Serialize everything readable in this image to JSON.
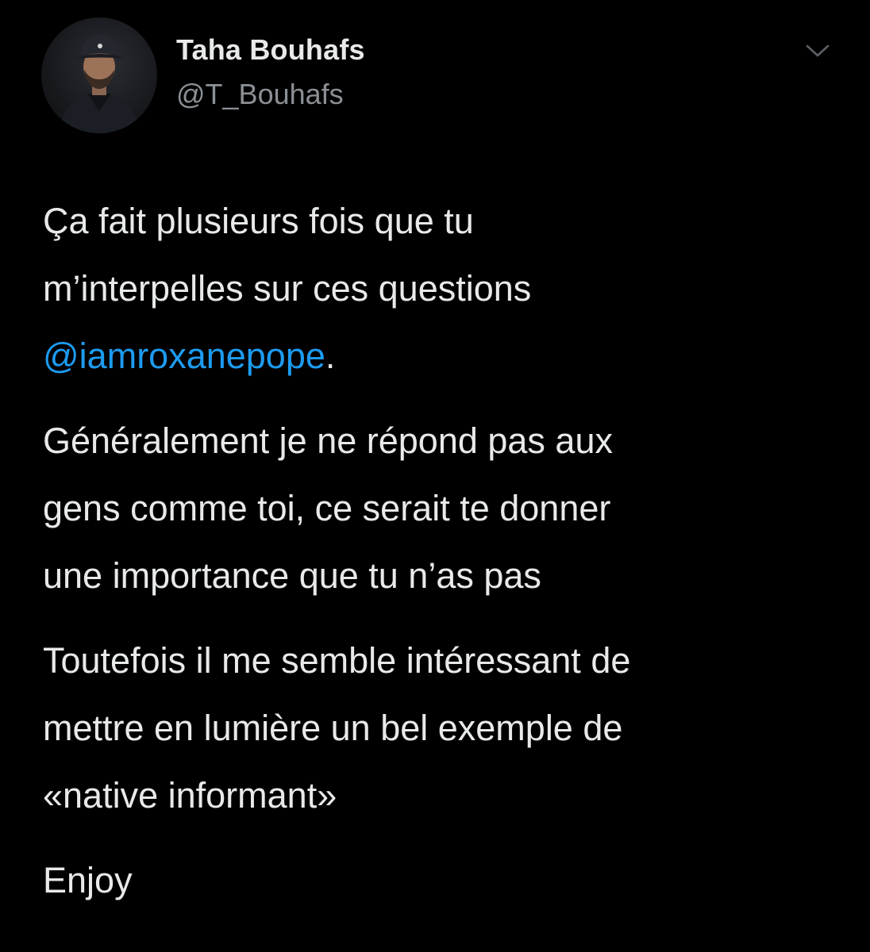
{
  "author": {
    "display_name": "Taha Bouhafs",
    "handle": "@T_Bouhafs",
    "avatar_icon": "user-avatar-photo"
  },
  "menu": {
    "icon": "chevron-down-icon"
  },
  "tweet": {
    "p1_line1": "Ça fait plusieurs fois que tu",
    "p1_line2": "m’interpelles sur ces questions",
    "p1_mention": "@iamroxanepope",
    "p1_after_mention": ".",
    "p2_line1": "Généralement je ne répond pas aux",
    "p2_line2": "gens comme toi, ce serait te donner",
    "p2_line3": "une importance que tu n’as pas",
    "p3_line1": "Toutefois il me semble intéressant de",
    "p3_line2": "mettre en lumière un bel exemple de",
    "p3_line3": "«native informant»",
    "p4_line1": "Enjoy"
  },
  "colors": {
    "background": "#000000",
    "text": "#e7e9ea",
    "secondary_text": "#8b9096",
    "link": "#1d9bf0"
  }
}
